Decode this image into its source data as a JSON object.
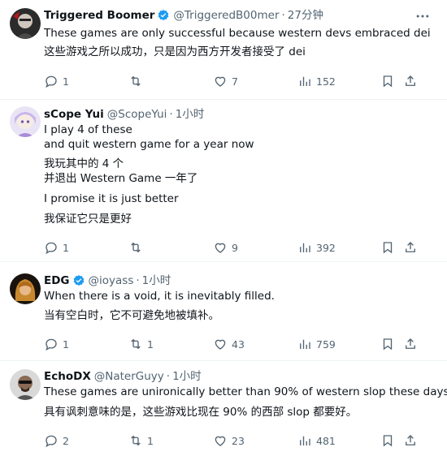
{
  "tweets": [
    {
      "name": "Triggered Boomer",
      "verified": true,
      "handle": "@TriggeredB00mer",
      "time": "27分钟",
      "lines": [
        "These games are only successful because western devs embraced dei",
        "这些游戏之所以成功，只是因为西方开发者接受了 dei"
      ],
      "replies": "1",
      "retweets": "",
      "likes": "7",
      "views": "152"
    },
    {
      "name": "sCope Yui",
      "verified": false,
      "handle": "@ScopeYui",
      "time": "1小时",
      "lines": [
        "I play 4 of these",
        "and quit western game for a year now",
        "我玩其中的 4 个",
        "并退出 Western Game 一年了",
        "I promise it is just better",
        "我保证它只是更好"
      ],
      "replies": "1",
      "retweets": "",
      "likes": "9",
      "views": "392"
    },
    {
      "name": "EDG",
      "verified": true,
      "handle": "@ioyass",
      "time": "1小时",
      "lines": [
        "When there is a void, it is inevitably filled.",
        "当有空白时，它不可避免地被填补。"
      ],
      "replies": "1",
      "retweets": "1",
      "likes": "43",
      "views": "759"
    },
    {
      "name": "EchoDX",
      "verified": false,
      "handle": "@NaterGuyy",
      "time": "1小时",
      "lines": [
        "These games are unironically better than 90% of western slop these days.",
        "具有讽刺意味的是，这些游戏比现在 90% 的西部 slop 都要好。"
      ],
      "replies": "2",
      "retweets": "1",
      "likes": "23",
      "views": "481"
    }
  ],
  "colors": {
    "text": "#0f1419",
    "secondary": "#536471",
    "verified": "#1d9bf0",
    "divider": "#eff3f4"
  },
  "icons": [
    "reply-icon",
    "retweet-icon",
    "like-icon",
    "views-icon",
    "bookmark-icon",
    "share-icon",
    "more-icon",
    "verified-badge-icon"
  ]
}
